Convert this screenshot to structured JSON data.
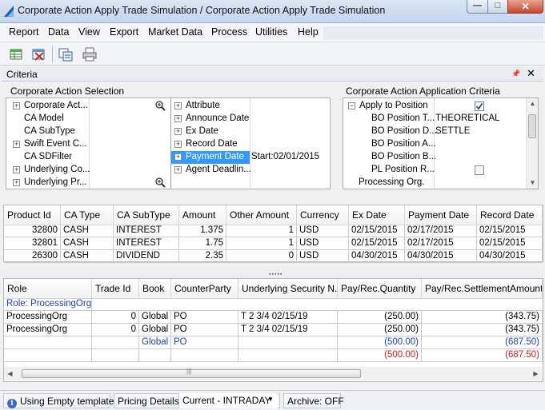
{
  "window": {
    "title": "Corporate Action Apply Trade Simulation / Corporate Action Apply Trade Simulation",
    "controls": {
      "minimize": "—",
      "maximize": "□",
      "close": "✕"
    }
  },
  "menu": [
    "Report",
    "Data",
    "View",
    "Export",
    "Market Data",
    "Process",
    "Utilities",
    "Help"
  ],
  "toolbar": {
    "icons": [
      "load-template-icon",
      "delete-icon",
      "copy-icon",
      "print-icon"
    ]
  },
  "criteria": {
    "title": "Criteria",
    "pin_glyph": "📌",
    "close_glyph": "✕"
  },
  "ca_selection": {
    "title": "Corporate Action Selection",
    "left_rows": [
      {
        "label": "Corporate Act...",
        "expandable": true,
        "magnify": true
      },
      {
        "label": "CA Model",
        "expandable": false
      },
      {
        "label": "CA SubType",
        "expandable": false
      },
      {
        "label": "Swift Event C...",
        "expandable": true
      },
      {
        "label": "CA SDFilter",
        "expandable": false
      },
      {
        "label": "Underlying Co...",
        "expandable": true
      },
      {
        "label": "Underlying Pr...",
        "expandable": true,
        "magnify": true
      }
    ],
    "right_rows": [
      {
        "label": "Attribute",
        "value": ""
      },
      {
        "label": "Announce Date",
        "value": ""
      },
      {
        "label": "Ex Date",
        "value": ""
      },
      {
        "label": "Record Date",
        "value": ""
      },
      {
        "label": "Payment Date",
        "value": "Start:02/01/2015",
        "selected": true
      },
      {
        "label": "Agent Deadlin...",
        "value": ""
      }
    ]
  },
  "ca_application": {
    "title": "Corporate Action Application Criteria",
    "rows": [
      {
        "label": "Apply to Position",
        "value": "",
        "checkbox": true,
        "checked": true,
        "expandable": true
      },
      {
        "label": "BO Position T...",
        "value": "THEORETICAL"
      },
      {
        "label": "BO Position D...",
        "value": "SETTLE"
      },
      {
        "label": "BO Position A...",
        "value": ""
      },
      {
        "label": "BO Position B...",
        "value": ""
      },
      {
        "label": "PL Position R...",
        "value": "",
        "checkbox": true,
        "checked": false
      },
      {
        "label": "Processing Org.",
        "value": ""
      }
    ]
  },
  "ca_table": {
    "columns": [
      "Product Id",
      "CA Type",
      "CA SubType",
      "Amount",
      "Other Amount",
      "Currency",
      "Ex Date",
      "Payment Date",
      "Record Date"
    ],
    "rows": [
      [
        "32800",
        "CASH",
        "INTEREST",
        "1.375",
        "1",
        "USD",
        "02/15/2015",
        "02/17/2015",
        "02/15/2015"
      ],
      [
        "32801",
        "CASH",
        "INTEREST",
        "1.75",
        "1",
        "USD",
        "02/15/2015",
        "02/17/2015",
        "02/15/2015"
      ],
      [
        "26300",
        "CASH",
        "DIVIDEND",
        "2.35",
        "0",
        "USD",
        "04/30/2015",
        "04/30/2015",
        "04/30/2015"
      ]
    ]
  },
  "trade_table": {
    "columns": [
      "Role",
      "Trade Id",
      "Book",
      "CounterParty",
      "Underlying Security N...",
      "Pay/Rec.Quantity",
      "Pay/Rec.SettlementAmount"
    ],
    "group_label": "Role: ProcessingOrg",
    "rows": [
      {
        "cells": [
          "ProcessingOrg",
          "0",
          "Global",
          "PO",
          "T 2 3/4 02/15/19",
          "(250.00)",
          "(343.75)"
        ],
        "style": "normal"
      },
      {
        "cells": [
          "ProcessingOrg",
          "0",
          "Global",
          "PO",
          "T 2 3/4 02/15/19",
          "(250.00)",
          "(343.75)"
        ],
        "style": "normal"
      },
      {
        "cells": [
          "",
          "",
          "Global",
          "PO",
          "",
          "(500.00)",
          "(687.50)"
        ],
        "style": "blue"
      },
      {
        "cells": [
          "",
          "",
          "",
          "",
          "",
          "(500.00)",
          "(687.50)"
        ],
        "style": "red"
      }
    ]
  },
  "status": {
    "template": "Using Empty template",
    "pricing_label": "Pricing Details:",
    "pricing_value": "Current - INTRADAY",
    "archive": "Archive: OFF"
  },
  "colors": {
    "selection": "#3399ff",
    "group_blue": "#1b3fbf",
    "total_red": "#d11a1a"
  }
}
